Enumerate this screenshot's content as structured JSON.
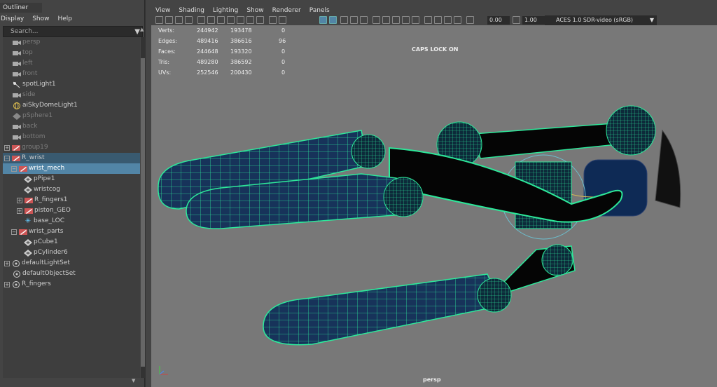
{
  "outliner": {
    "title": "Outliner",
    "menu": [
      "Display",
      "Show",
      "Help"
    ],
    "search_placeholder": "Search...",
    "items": [
      {
        "label": "persp",
        "dim": true
      },
      {
        "label": "top",
        "dim": true
      },
      {
        "label": "left",
        "dim": true
      },
      {
        "label": "front",
        "dim": true
      },
      {
        "label": "spotLight1",
        "dim": false
      },
      {
        "label": "side",
        "dim": true
      },
      {
        "label": "aiSkyDomeLight1",
        "dim": false
      },
      {
        "label": "pSphere1",
        "dim": true
      },
      {
        "label": "back",
        "dim": true
      },
      {
        "label": "bottom",
        "dim": true
      },
      {
        "label": "group19",
        "dim": true
      },
      {
        "label": "R_wrist",
        "dim": false
      },
      {
        "label": "wrist_mech",
        "dim": false
      },
      {
        "label": "pPipe1",
        "dim": false
      },
      {
        "label": "wristcog",
        "dim": false
      },
      {
        "label": "R_fingers1",
        "dim": false
      },
      {
        "label": "piston_GEO",
        "dim": false
      },
      {
        "label": "base_LOC",
        "dim": false
      },
      {
        "label": "wrist_parts",
        "dim": false
      },
      {
        "label": "pCube1",
        "dim": false
      },
      {
        "label": "pCylinder6",
        "dim": false
      },
      {
        "label": "defaultLightSet",
        "dim": false
      },
      {
        "label": "defaultObjectSet",
        "dim": false
      },
      {
        "label": "R_fingers",
        "dim": false
      }
    ]
  },
  "viewport_menu": [
    "View",
    "Shading",
    "Lighting",
    "Show",
    "Renderer",
    "Panels"
  ],
  "toolbar": {
    "exposure": "0.00",
    "gamma": "1.00",
    "color_space": "ACES 1.0 SDR-video (sRGB)"
  },
  "hud": {
    "rows": [
      {
        "label": "Verts:",
        "a": "244942",
        "b": "193478",
        "c": "0"
      },
      {
        "label": "Edges:",
        "a": "489416",
        "b": "386616",
        "c": "96"
      },
      {
        "label": "Faces:",
        "a": "244648",
        "b": "193320",
        "c": "0"
      },
      {
        "label": "Tris:",
        "a": "489280",
        "b": "386592",
        "c": "0"
      },
      {
        "label": "UVs:",
        "a": "252546",
        "b": "200430",
        "c": "0"
      }
    ],
    "capslock": "CAPS LOCK ON",
    "camera": "persp"
  },
  "colors": {
    "selection": "#5285a6",
    "wire": "#2de89a",
    "mesh": "#17335a"
  }
}
